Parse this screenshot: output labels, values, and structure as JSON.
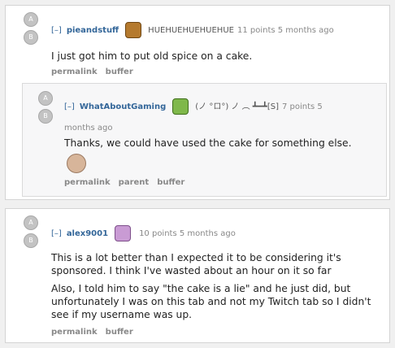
{
  "comment1": {
    "vote_up": "A",
    "vote_down": "B",
    "expand": "[–]",
    "author": "pieandstuff",
    "flair": "HUEHUEHUEHUEHUE",
    "score": "11 points 5 months ago",
    "body": "I just got him to put old spice on a cake.",
    "buttons": {
      "permalink": "permalink",
      "buffer": "buffer"
    }
  },
  "comment2": {
    "vote_up": "A",
    "vote_down": "B",
    "expand": "[–]",
    "author": "WhatAboutGaming",
    "flair": "(ノ °ロ°) ノ ︵ ┻━┻[S]",
    "score": "7 points 5",
    "score_cont": "months ago",
    "body": "Thanks, we could have used the cake for something else.",
    "buttons": {
      "permalink": "permalink",
      "parent": "parent",
      "buffer": "buffer"
    }
  },
  "comment3": {
    "vote_up": "A",
    "vote_down": "B",
    "expand": "[–]",
    "author": "alex9001",
    "score": "10 points 5 months ago",
    "body_p1": "This is a lot better than I expected it to be considering it's sponsored. I think I've wasted about an hour on it so far",
    "body_p2": "Also, I told him to say \"the cake is a lie\" and he just did, but unfortunately I was on this tab and not my Twitch tab so I didn't see if my username was up.",
    "buttons": {
      "permalink": "permalink",
      "buffer": "buffer"
    }
  },
  "colors": {
    "author": "#336699",
    "background": "#f0f0f0",
    "nested_bg": "#f7f7f8",
    "vote_button": "#c3c3c3"
  }
}
